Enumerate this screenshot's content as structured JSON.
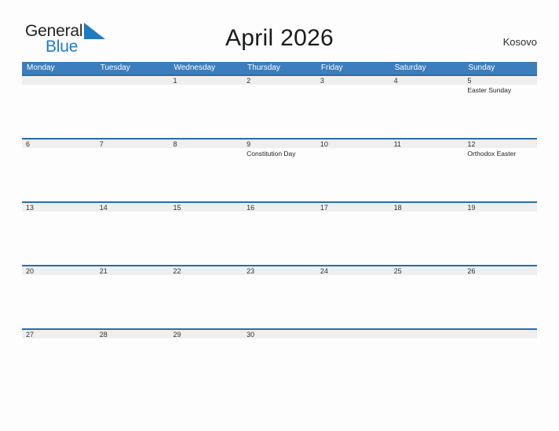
{
  "brand": {
    "word_one": "General",
    "word_two": "Blue",
    "triangle_icon": "blue-triangle-icon",
    "color_dark": "#231f20",
    "color_blue": "#1f7ac4"
  },
  "header": {
    "title": "April 2026",
    "country": "Kosovo"
  },
  "colors": {
    "header_blue": "#3b7dbd",
    "row_rule_blue": "#2a6ca8",
    "number_band": "#efefef",
    "page_background": "#fdfdfd",
    "text": "#232323"
  },
  "calendar": {
    "month": "April",
    "year": "2026",
    "weekday_headers": [
      "Monday",
      "Tuesday",
      "Wednesday",
      "Thursday",
      "Friday",
      "Saturday",
      "Sunday"
    ],
    "weeks": [
      {
        "days": [
          {
            "number": "",
            "event": ""
          },
          {
            "number": "",
            "event": ""
          },
          {
            "number": "1",
            "event": ""
          },
          {
            "number": "2",
            "event": ""
          },
          {
            "number": "3",
            "event": ""
          },
          {
            "number": "4",
            "event": ""
          },
          {
            "number": "5",
            "event": "Easter Sunday"
          }
        ]
      },
      {
        "days": [
          {
            "number": "6",
            "event": ""
          },
          {
            "number": "7",
            "event": ""
          },
          {
            "number": "8",
            "event": ""
          },
          {
            "number": "9",
            "event": "Constitution Day"
          },
          {
            "number": "10",
            "event": ""
          },
          {
            "number": "11",
            "event": ""
          },
          {
            "number": "12",
            "event": "Orthodox Easter"
          }
        ]
      },
      {
        "days": [
          {
            "number": "13",
            "event": ""
          },
          {
            "number": "14",
            "event": ""
          },
          {
            "number": "15",
            "event": ""
          },
          {
            "number": "16",
            "event": ""
          },
          {
            "number": "17",
            "event": ""
          },
          {
            "number": "18",
            "event": ""
          },
          {
            "number": "19",
            "event": ""
          }
        ]
      },
      {
        "days": [
          {
            "number": "20",
            "event": ""
          },
          {
            "number": "21",
            "event": ""
          },
          {
            "number": "22",
            "event": ""
          },
          {
            "number": "23",
            "event": ""
          },
          {
            "number": "24",
            "event": ""
          },
          {
            "number": "25",
            "event": ""
          },
          {
            "number": "26",
            "event": ""
          }
        ]
      },
      {
        "days": [
          {
            "number": "27",
            "event": ""
          },
          {
            "number": "28",
            "event": ""
          },
          {
            "number": "29",
            "event": ""
          },
          {
            "number": "30",
            "event": ""
          },
          {
            "number": "",
            "event": ""
          },
          {
            "number": "",
            "event": ""
          },
          {
            "number": "",
            "event": ""
          }
        ]
      }
    ]
  }
}
